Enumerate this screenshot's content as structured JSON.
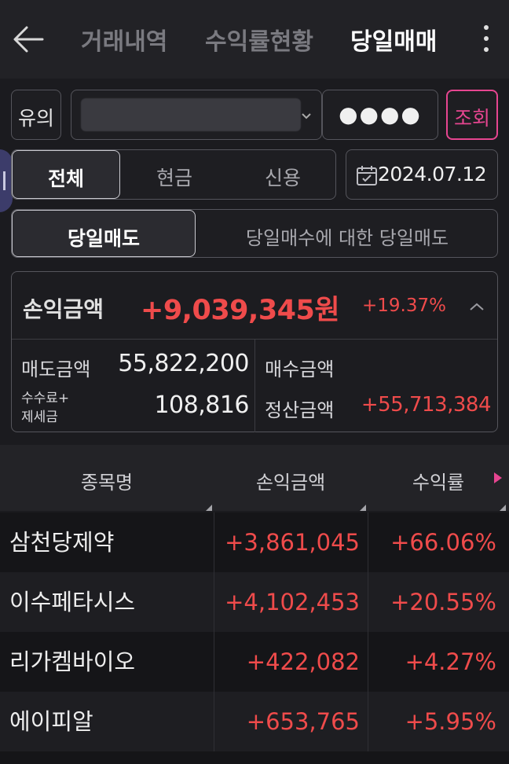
{
  "header": {
    "tabs": [
      {
        "label": "거래내역",
        "active": false
      },
      {
        "label": "수익률현황",
        "active": false
      },
      {
        "label": "당일매매",
        "active": true
      }
    ],
    "back_icon": "arrow-left-icon",
    "more_icon": "more-vertical-icon"
  },
  "filter": {
    "notice_button": "유의",
    "account_masked": "",
    "password_mask": "●●●●",
    "search_button": "조회"
  },
  "account_type_tabs": [
    {
      "label": "전체",
      "active": true
    },
    {
      "label": "현금",
      "active": false
    },
    {
      "label": "신용",
      "active": false
    }
  ],
  "date": {
    "value": "2024.07.12",
    "icon": "calendar-icon"
  },
  "trade_tabs": [
    {
      "label": "당일매도",
      "active": true
    },
    {
      "label": "당일매수에 대한 당일매도",
      "active": false
    }
  ],
  "summary": {
    "pnl_label": "손익금액",
    "pnl_value": "+9,039,345원",
    "pnl_rate": "+19.37%",
    "sell_amount_label": "매도금액",
    "sell_amount_value": "55,822,200",
    "fee_label_line1": "수수료+",
    "fee_label_line2": "제세금",
    "fee_value": "108,816",
    "buy_amount_label": "매수금액",
    "buy_amount_value": "",
    "settle_label": "정산금액",
    "settle_value": "+55,713,384"
  },
  "table": {
    "columns": [
      "종목명",
      "손익금액",
      "수익률"
    ],
    "rows": [
      {
        "name": "삼천당제약",
        "pnl": "+3,861,045",
        "rate": "+66.06%"
      },
      {
        "name": "이수페타시스",
        "pnl": "+4,102,453",
        "rate": "+20.55%"
      },
      {
        "name": "리가켐바이오",
        "pnl": "+422,082",
        "rate": "+4.27%"
      },
      {
        "name": "에이피알",
        "pnl": "+653,765",
        "rate": "+5.95%"
      }
    ]
  },
  "colors": {
    "accent_red": "#ef4b4b",
    "search_pink": "#e64590",
    "bg": "#1b1b1f"
  }
}
